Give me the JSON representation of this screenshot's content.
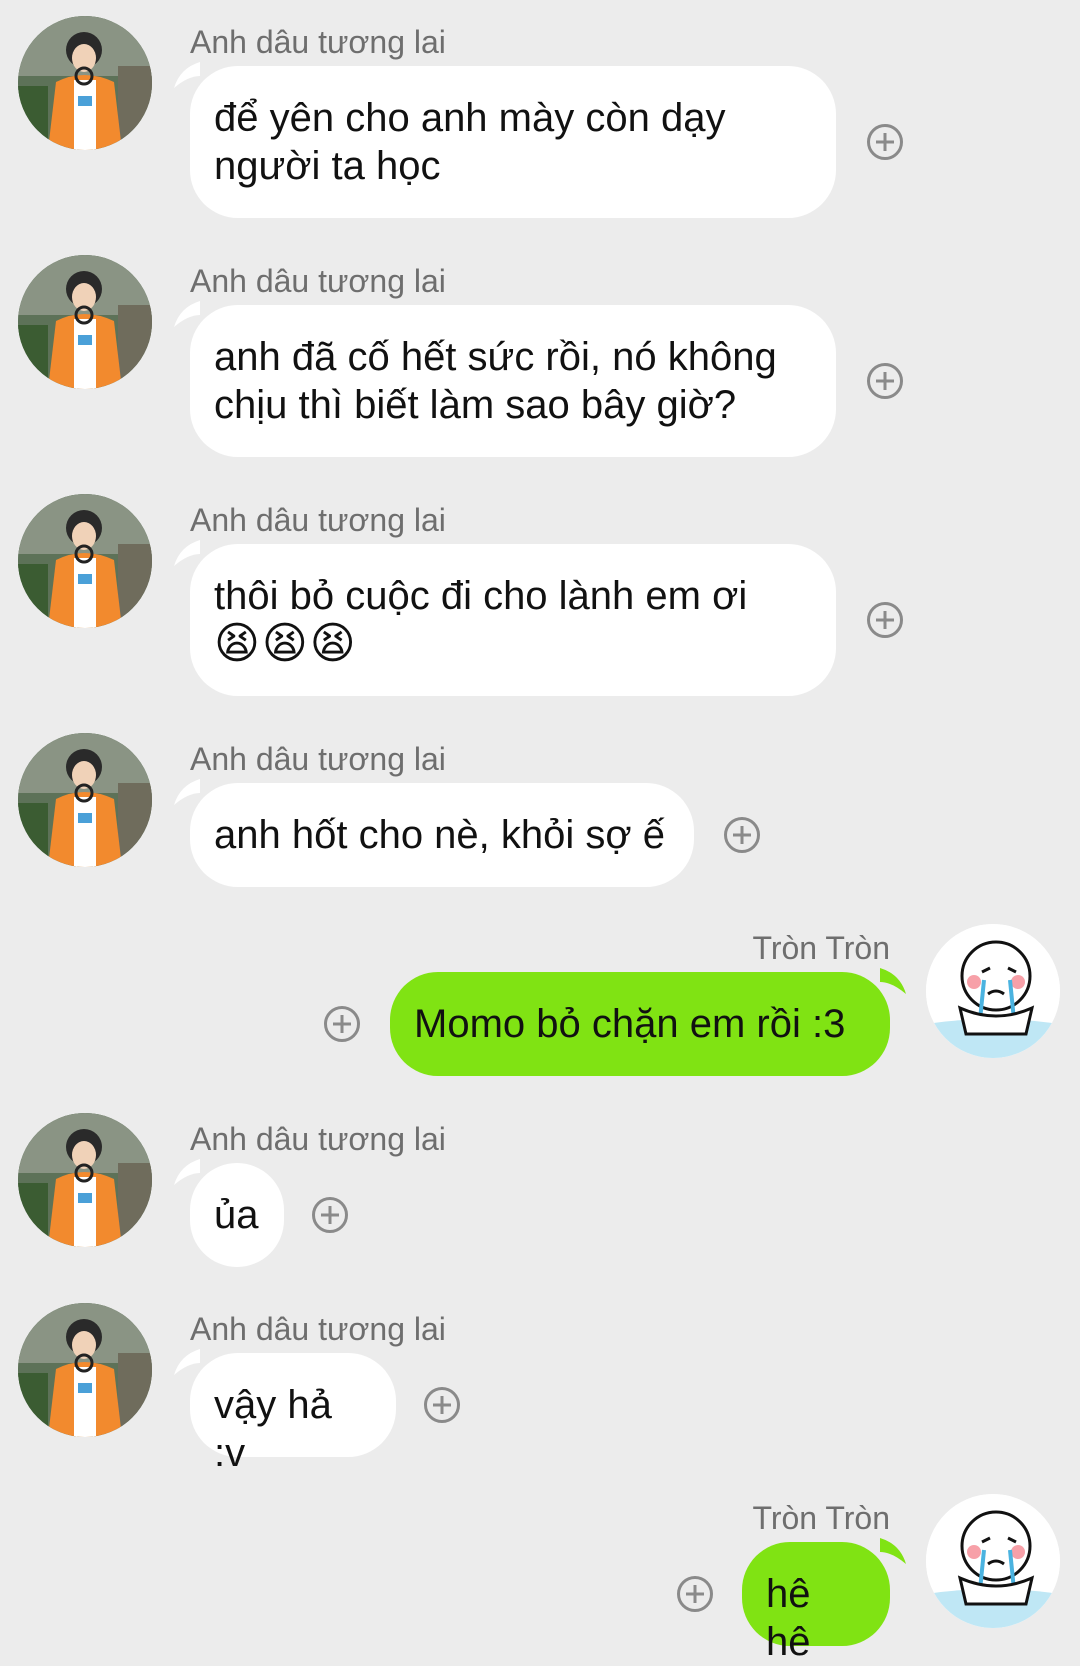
{
  "theme": {
    "background": "#ececec",
    "incoming_bubble": "#ffffff",
    "outgoing_bubble": "#80e313",
    "sender_text": "#6e6e6e"
  },
  "messages": [
    {
      "sender": "Anh dâu tương lai",
      "text": "để yên cho anh mày còn dạy người ta học",
      "direction": "incoming"
    },
    {
      "sender": "Anh dâu tương lai",
      "text": "anh đã cố hết sức rồi, nó không chịu thì biết làm sao bây giờ?",
      "direction": "incoming"
    },
    {
      "sender": "Anh dâu tương lai",
      "text": "thôi bỏ cuộc đi cho lành em ơi",
      "emoji": "😫😫😫",
      "direction": "incoming"
    },
    {
      "sender": "Anh dâu tương lai",
      "text": "anh hốt cho nè, khỏi sợ ế",
      "direction": "incoming"
    },
    {
      "sender": "Tròn Tròn",
      "text": "Momo bỏ chặn em rồi :3",
      "direction": "outgoing"
    },
    {
      "sender": "Anh dâu tương lai",
      "text": "ủa",
      "direction": "incoming"
    },
    {
      "sender": "Anh dâu tương lai",
      "text": "vậy hả :v",
      "direction": "incoming"
    },
    {
      "sender": "Tròn Tròn",
      "text": "hê hê",
      "direction": "outgoing"
    }
  ],
  "icons": {
    "reaction": "add-reaction-icon",
    "avatar_incoming": "user-avatar",
    "avatar_outgoing": "crying-sticker-avatar"
  }
}
